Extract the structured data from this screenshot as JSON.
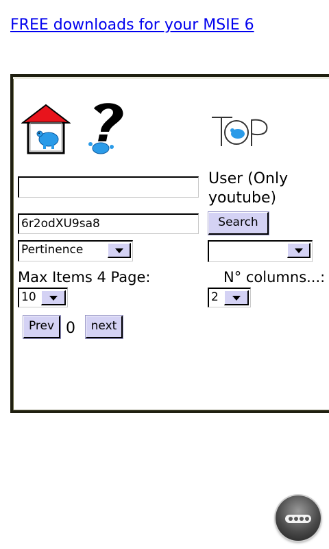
{
  "header": {
    "promo_link": "FREE downloads for your MSIE 6"
  },
  "icons": {
    "home": "home-icon",
    "help": "help-icon",
    "top": "top-icon"
  },
  "search_form": {
    "search_value": "",
    "query_value": "6r2odXU9sa8",
    "user_label": "User (Only youtube)",
    "search_button": "Search",
    "sort_select": "Pertinence",
    "user_select": "",
    "max_items_label": "Max Items 4 Page:",
    "max_items_value": "10",
    "columns_label": "N° columns...:",
    "columns_value": "2"
  },
  "pagination": {
    "prev_label": "Prev",
    "page_number": "0",
    "next_label": "next"
  },
  "colors": {
    "link": "#0000ee",
    "button": "#d4d2f4",
    "frame_border": "#1f1f10"
  }
}
